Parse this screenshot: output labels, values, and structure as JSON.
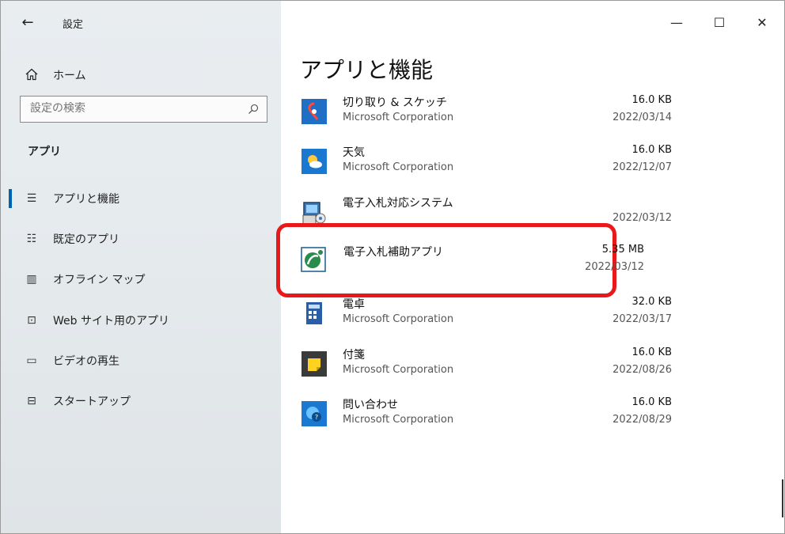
{
  "window": {
    "title": "設定",
    "back_glyph": "←",
    "minimize_glyph": "—",
    "maximize_glyph": "☐",
    "close_glyph": "✕"
  },
  "sidebar": {
    "home_label": "ホーム",
    "search": {
      "placeholder": "設定の検索"
    },
    "section_heading": "アプリ",
    "items": [
      {
        "label": "アプリと機能",
        "icon": "apps-features-icon",
        "glyph": "☰",
        "active": true
      },
      {
        "label": "既定のアプリ",
        "icon": "default-apps-icon",
        "glyph": "☷",
        "active": false
      },
      {
        "label": "オフライン マップ",
        "icon": "offline-maps-icon",
        "glyph": "▥",
        "active": false
      },
      {
        "label": "Web サイト用のアプリ",
        "icon": "apps-for-websites-icon",
        "glyph": "⊡",
        "active": false
      },
      {
        "label": "ビデオの再生",
        "icon": "video-playback-icon",
        "glyph": "▭",
        "active": false
      },
      {
        "label": "スタートアップ",
        "icon": "startup-icon",
        "glyph": "⊟",
        "active": false
      }
    ]
  },
  "main": {
    "title": "アプリと機能",
    "apps": [
      {
        "name": "切り取り & スケッチ",
        "publisher": "Microsoft Corporation",
        "size": "16.0 KB",
        "date": "2022/03/14",
        "icon": "snip-sketch-icon",
        "color": "#1f6fc6"
      },
      {
        "name": "天気",
        "publisher": "Microsoft Corporation",
        "size": "16.0 KB",
        "date": "2022/12/07",
        "icon": "weather-icon",
        "color": "#1b78d0"
      },
      {
        "name": "電子入札対応システム",
        "publisher": "",
        "size": "",
        "date": "2022/03/12",
        "icon": "e-bidding-system-icon",
        "color": "#3c7bb8"
      },
      {
        "name": "電子入札補助アプリ",
        "publisher": "",
        "size": "5.35 MB",
        "date": "2022/03/12",
        "icon": "e-bidding-helper-icon",
        "color": "#2a8c4a"
      },
      {
        "name": "電卓",
        "publisher": "Microsoft Corporation",
        "size": "32.0 KB",
        "date": "2022/03/17",
        "icon": "calculator-icon",
        "color": "#2a5fa8"
      },
      {
        "name": "付箋",
        "publisher": "Microsoft Corporation",
        "size": "16.0 KB",
        "date": "2022/08/26",
        "icon": "sticky-notes-icon",
        "color": "#3a3a3a"
      },
      {
        "name": "問い合わせ",
        "publisher": "Microsoft Corporation",
        "size": "16.0 KB",
        "date": "2022/08/29",
        "icon": "get-help-icon",
        "color": "#1b78d0"
      }
    ]
  },
  "colors": {
    "accent": "#0063b1",
    "highlight": "#e8191b"
  }
}
